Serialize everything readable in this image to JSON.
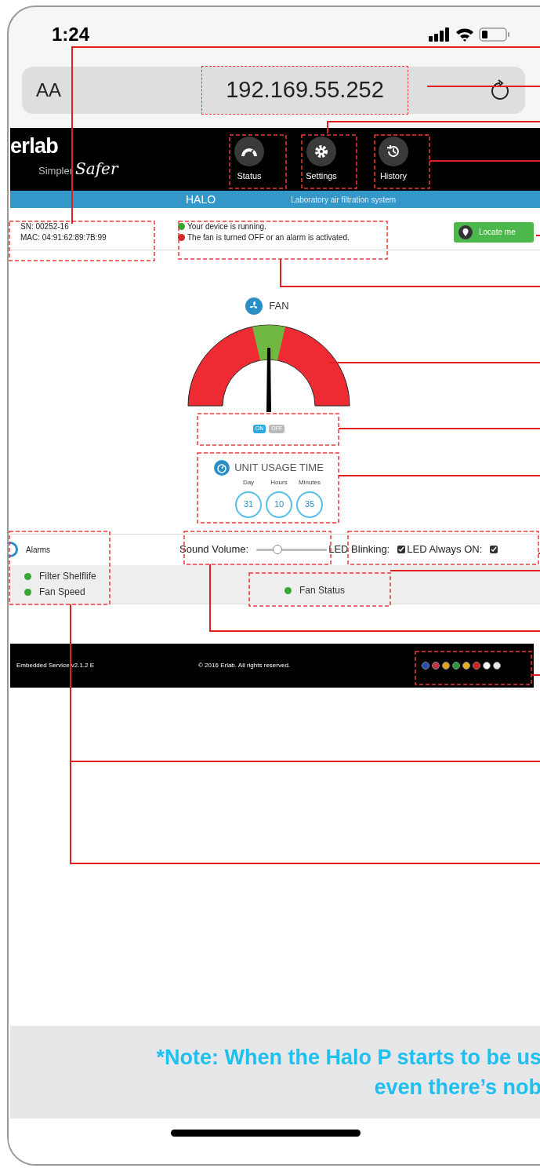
{
  "status_bar": {
    "time": "1:24"
  },
  "address_bar": {
    "text_size": "AA",
    "url": "192.169.55.252"
  },
  "header": {
    "logo": "erlab",
    "tagline_1": "Simpler",
    "tagline_2": "Safer",
    "nav": [
      {
        "label": "Status",
        "kind": "gauge"
      },
      {
        "label": "Settings",
        "kind": "gear"
      },
      {
        "label": "History",
        "kind": "history"
      }
    ]
  },
  "banner": {
    "title": "HALO",
    "subtitle": "Laboratory air filtration system"
  },
  "device": {
    "sn": "SN: 00252-16",
    "mac": "MAC: 04:91:62:89:7B:99"
  },
  "legend": [
    {
      "text": "Your device is running.",
      "color": "#2fa82f"
    },
    {
      "text": "The fan is turned OFF or an alarm is activated.",
      "color": "#d02a2a"
    }
  ],
  "locate_button": "Locate me",
  "fan": {
    "title": "FAN",
    "toggle": [
      {
        "label": "ON",
        "selected": true
      },
      {
        "label": "OFF",
        "selected": false
      }
    ]
  },
  "usage": {
    "title": "UNIT USAGE TIME",
    "units": [
      {
        "label": "Day",
        "value": "31"
      },
      {
        "label": "Hours",
        "value": "10"
      },
      {
        "label": "Minutes",
        "value": "35"
      }
    ]
  },
  "controls": {
    "alarms_title": "Alarms",
    "sound_label": "Sound Volume:",
    "sound_level": {
      "level": 0.3
    },
    "checks": [
      {
        "label": "LED Blinking:",
        "checked": true
      },
      {
        "label": "LED Always ON:",
        "checked": true
      }
    ]
  },
  "alarms": [
    {
      "label": "Filter Shelflife",
      "color": "#35a835"
    },
    {
      "label": "Fan Speed",
      "color": "#35a835"
    }
  ],
  "fan_status": {
    "label": "Fan Status",
    "color": "#35a835"
  },
  "footer": {
    "version": "Embedded Service v2.1.2 E",
    "copyright": "© 2016 Erlab. All rights reserved.",
    "flags": [
      {
        "color": "#2a4bb0"
      },
      {
        "color": "#c0304a"
      },
      {
        "color": "#e0a020"
      },
      {
        "color": "#2a9a40"
      },
      {
        "color": "#e0b020"
      },
      {
        "color": "#d02020"
      },
      {
        "color": "#f4f4f4"
      },
      {
        "color": "#e8e8f0"
      }
    ]
  },
  "note": {
    "line_1": "*Note: When the Halo P starts to be us",
    "line_2": "even there’s nob"
  }
}
